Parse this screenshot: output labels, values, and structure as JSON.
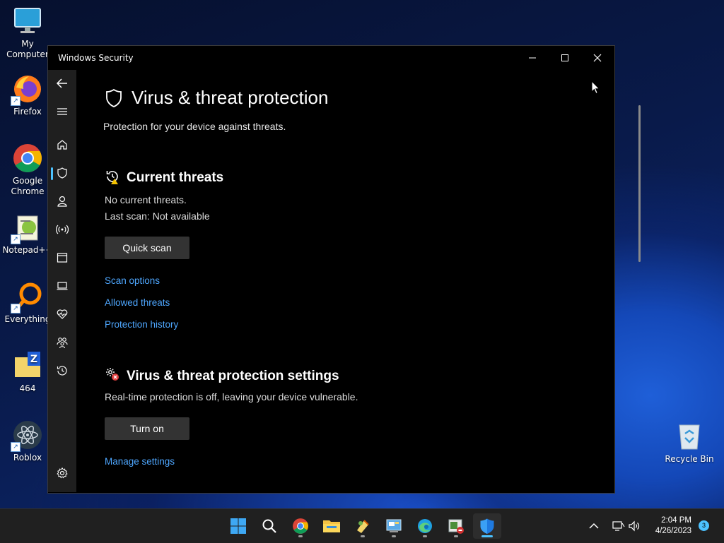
{
  "desktop": {
    "icons": [
      {
        "label": "My Computer"
      },
      {
        "label": "Firefox"
      },
      {
        "label": "Google Chrome"
      },
      {
        "label": "Notepad++"
      },
      {
        "label": "Everything"
      },
      {
        "label": "464"
      },
      {
        "label": "Roblox"
      },
      {
        "label": "Recycle Bin"
      }
    ]
  },
  "window": {
    "title": "Windows Security",
    "page_title": "Virus & threat protection",
    "page_subtitle": "Protection for your device against threats.",
    "current_threats": {
      "title": "Current threats",
      "status": "No current threats.",
      "last_scan": "Last scan: Not available",
      "quick_scan_label": "Quick scan",
      "links": [
        "Scan options",
        "Allowed threats",
        "Protection history"
      ]
    },
    "settings": {
      "title": "Virus & threat protection settings",
      "status": "Real-time protection is off, leaving your device vulnerable.",
      "turn_on_label": "Turn on",
      "manage_link": "Manage settings"
    },
    "nav_items": [
      "back-icon",
      "menu-icon",
      "home-icon",
      "shield-icon",
      "account-icon",
      "firewall-icon",
      "app-browser-icon",
      "device-security-icon",
      "health-icon",
      "family-icon",
      "history-icon",
      "settings-icon"
    ]
  },
  "taskbar": {
    "time": "2:04 PM",
    "date": "4/26/2023",
    "notification_count": "3"
  },
  "colors": {
    "accent": "#4cc2ff",
    "link": "#4ea7ff",
    "button": "#333333"
  }
}
